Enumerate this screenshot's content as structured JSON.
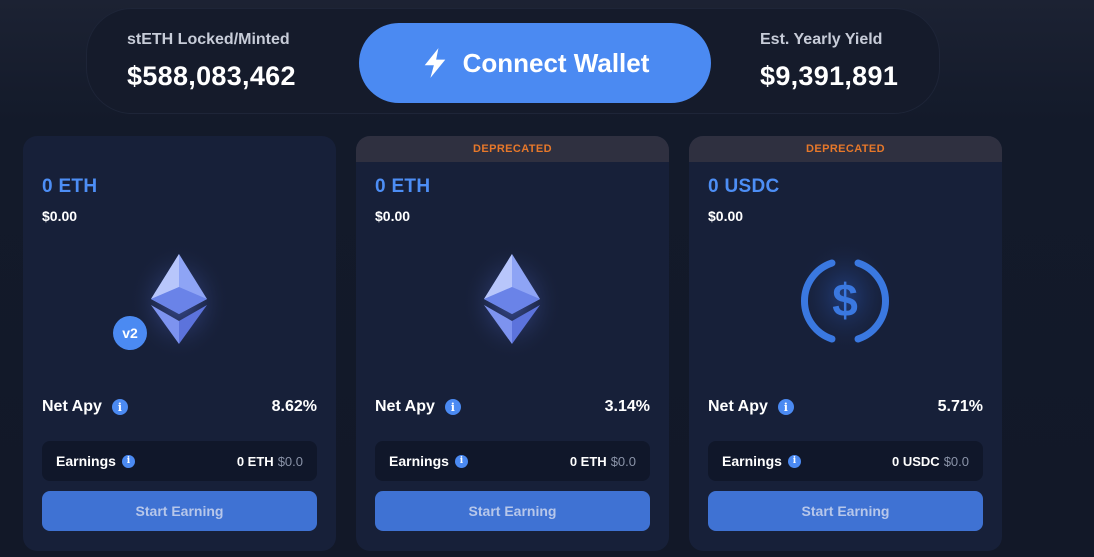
{
  "stats": {
    "left_label": "stETH Locked/Minted",
    "left_value": "$588,083,462",
    "right_label": "Est. Yearly Yield",
    "right_value": "$9,391,891"
  },
  "connect_button": {
    "label": "Connect Wallet",
    "icon": "lightning-icon"
  },
  "colors": {
    "accent": "#4b8af2",
    "deprecated": "#e7782a",
    "card_bg": "#172039"
  },
  "cards": [
    {
      "banner": "",
      "amount": "0 ETH",
      "usd": "$0.00",
      "token_icon": "ethereum-icon",
      "badge": "v2",
      "apy_label": "Net Apy",
      "apy_value": "8.62%",
      "earnings_label": "Earnings",
      "earnings_amount": "0 ETH",
      "earnings_usd": "$0.0",
      "button_label": "Start Earning"
    },
    {
      "banner": "DEPRECATED",
      "amount": "0 ETH",
      "usd": "$0.00",
      "token_icon": "ethereum-icon",
      "apy_label": "Net Apy",
      "apy_value": "3.14%",
      "earnings_label": "Earnings",
      "earnings_amount": "0 ETH",
      "earnings_usd": "$0.0",
      "button_label": "Start Earning"
    },
    {
      "banner": "DEPRECATED",
      "amount": "0 USDC",
      "usd": "$0.00",
      "token_icon": "usdc-icon",
      "apy_label": "Net Apy",
      "apy_value": "5.71%",
      "earnings_label": "Earnings",
      "earnings_amount": "0 USDC",
      "earnings_usd": "$0.0",
      "button_label": "Start Earning"
    }
  ]
}
